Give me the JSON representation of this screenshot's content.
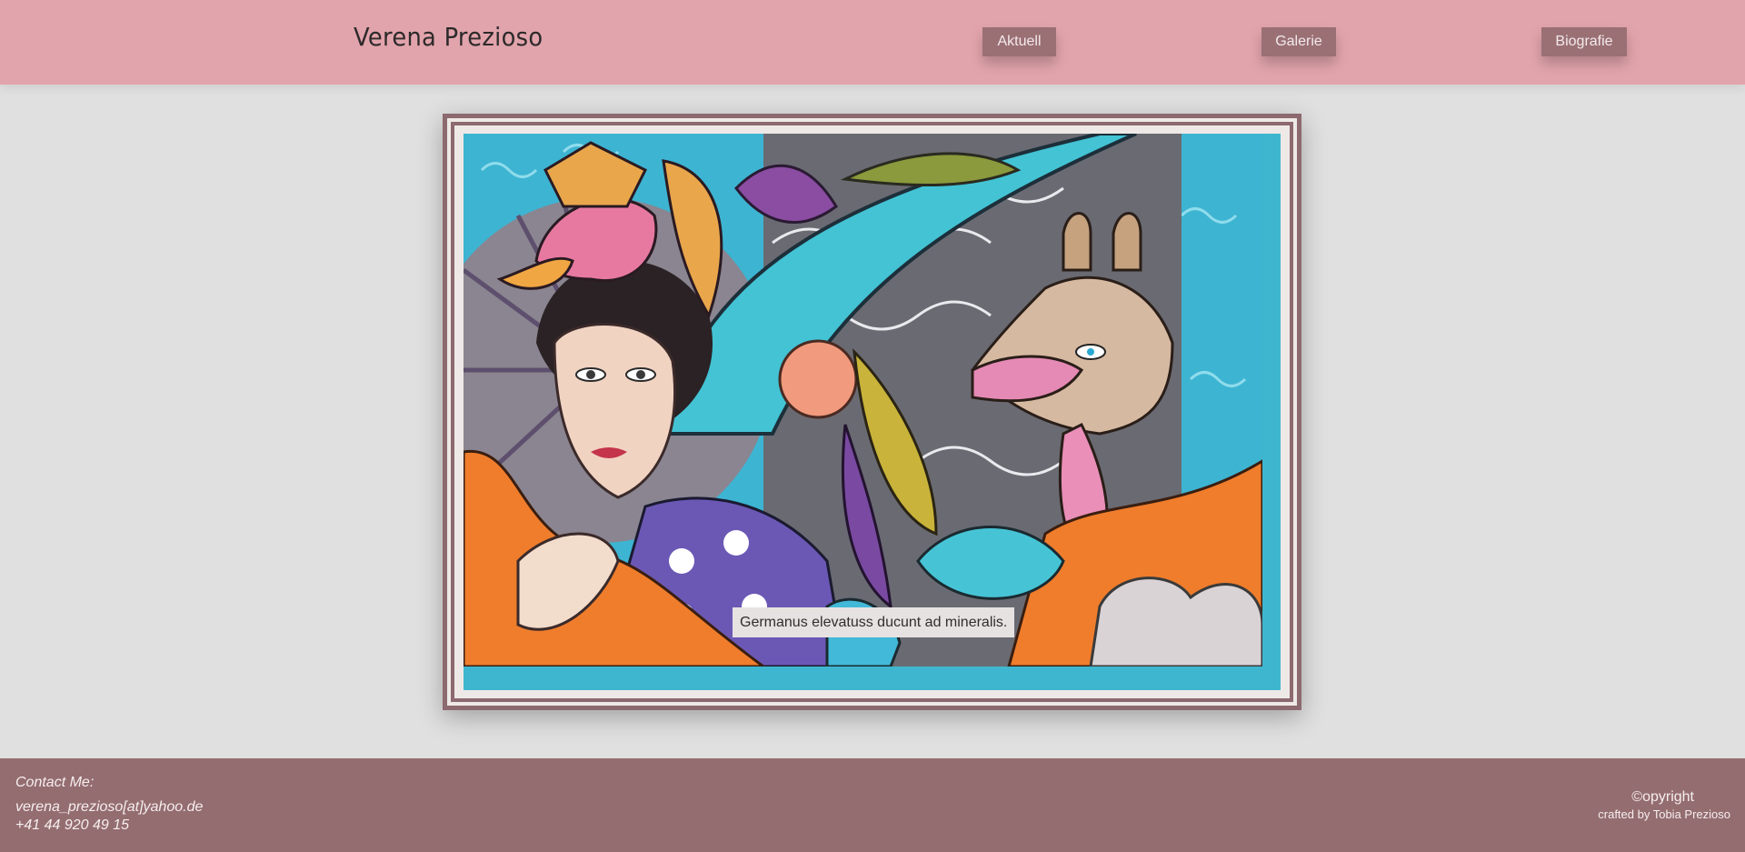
{
  "header": {
    "brand": "Verena Prezioso",
    "nav": {
      "aktuell": "Aktuell",
      "galerie": "Galerie",
      "biografie": "Biografie"
    }
  },
  "main": {
    "caption": "Germanus elevatuss ducunt ad mineralis."
  },
  "footer": {
    "contact_title": "Contact Me:",
    "email": "verena_prezioso[at]yahoo.de",
    "phone": "+41 44 920 49 15",
    "copyright": "©opyright",
    "crafted": "crafted by Tobia Prezioso"
  },
  "colors": {
    "header_bg": "#e2a4ac",
    "nav_button_bg": "#9a7075",
    "frame": "#8c6a6f",
    "footer_bg": "#946d70",
    "page_bg": "#e0e0e0"
  }
}
